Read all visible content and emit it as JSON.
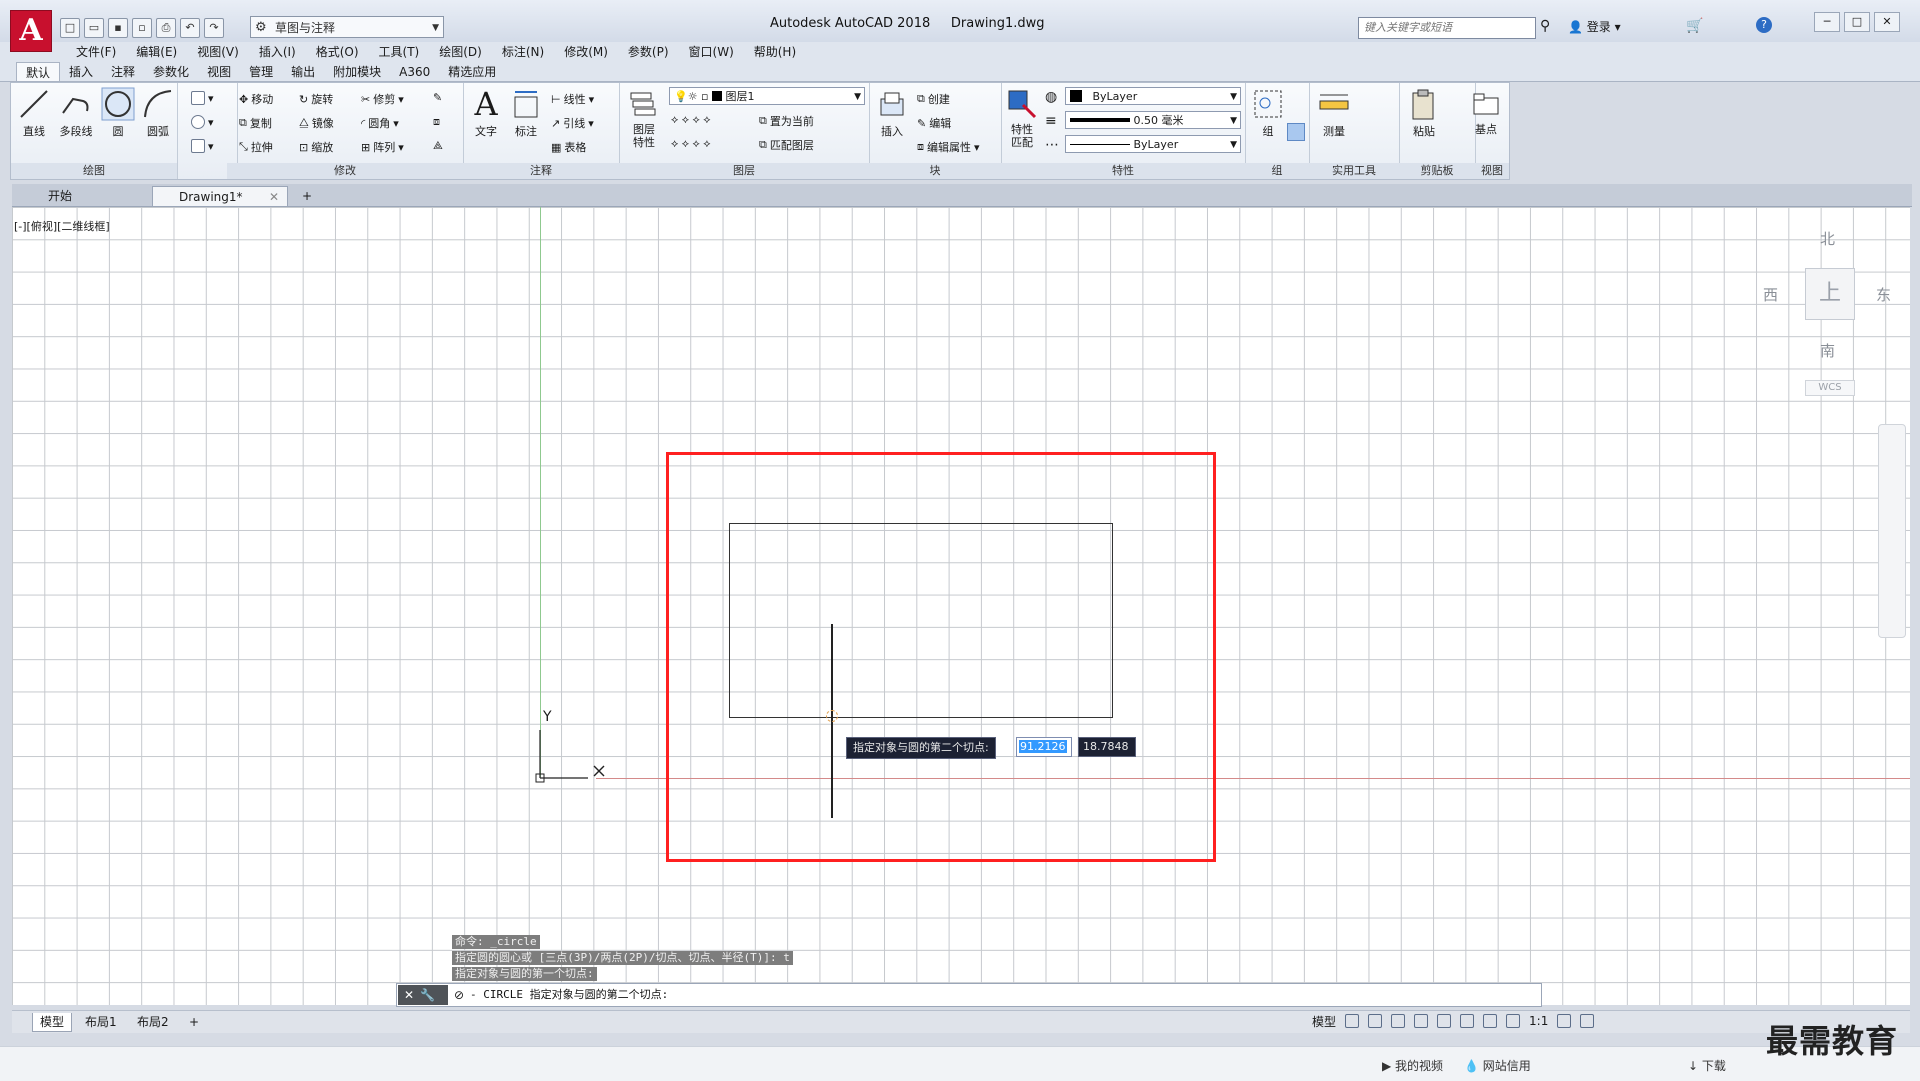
{
  "app": {
    "logo_letter": "A",
    "title": "Autodesk AutoCAD 2018",
    "document": "Drawing1.dwg",
    "workspace": "草图与注释",
    "search_placeholder": "键入关键字或短语",
    "login": "登录"
  },
  "menu": [
    "文件(F)",
    "编辑(E)",
    "视图(V)",
    "插入(I)",
    "格式(O)",
    "工具(T)",
    "绘图(D)",
    "标注(N)",
    "修改(M)",
    "参数(P)",
    "窗口(W)",
    "帮助(H)"
  ],
  "ribbon_tabs": [
    "默认",
    "插入",
    "注释",
    "参数化",
    "视图",
    "管理",
    "输出",
    "附加模块",
    "A360",
    "精选应用"
  ],
  "ribbon": {
    "draw": {
      "title": "绘图",
      "tools": [
        "直线",
        "多段线",
        "圆",
        "圆弧"
      ]
    },
    "modify": {
      "title": "修改",
      "rows": [
        [
          "移动",
          "旋转",
          "修剪"
        ],
        [
          "复制",
          "镜像",
          "圆角"
        ],
        [
          "拉伸",
          "缩放",
          "阵列"
        ]
      ]
    },
    "annotation": {
      "title": "注释",
      "tools": [
        "文字",
        "标注"
      ],
      "rows": [
        "线性",
        "引线",
        "表格"
      ]
    },
    "layers": {
      "title": "图层",
      "big": "图层\n特性",
      "layer_name": "图层1",
      "rows": [
        "置为当前",
        "匹配图层"
      ]
    },
    "block": {
      "title": "块",
      "big": "插入",
      "rows": [
        "创建",
        "编辑",
        "编辑属性"
      ]
    },
    "properties": {
      "title": "特性",
      "big": "特性\n匹配",
      "color": "ByLayer",
      "lineweight": "0.50 毫米",
      "linetype": "ByLayer"
    },
    "groups": {
      "title": "组",
      "big": "组"
    },
    "utilities": {
      "title": "实用工具",
      "big": "测量"
    },
    "clipboard": {
      "title": "剪贴板",
      "big": "粘贴"
    },
    "view": {
      "title": "视图",
      "big": "基点"
    }
  },
  "doc_tabs": [
    "开始",
    "Drawing1*"
  ],
  "viewport_label": "[-][俯视][二维线框]",
  "viewcube": {
    "north": "北",
    "south": "南",
    "east": "东",
    "west": "西",
    "face": "上",
    "wcs": "WCS"
  },
  "ucs": {
    "x": "X",
    "y": "Y"
  },
  "dynamic_input": {
    "prompt": "指定对象与圆的第二个切点:",
    "x_value": "91.2126",
    "y_value": "18.7848"
  },
  "command_history": [
    "命令: _circle",
    "指定圆的圆心或 [三点(3P)/两点(2P)/切点、切点、半径(T)]: t",
    "指定对象与圆的第一个切点:"
  ],
  "command_line": "CIRCLE 指定对象与圆的第二个切点:",
  "layout_tabs": [
    "模型",
    "布局1",
    "布局2"
  ],
  "status": {
    "model": "模型",
    "scale": "1:1"
  },
  "bottom_bar": {
    "video": "我的视频",
    "website": "网站信用",
    "download": "下载"
  },
  "watermark": "最需教育",
  "colors": {
    "highlight_box": "#ff2020",
    "crosshair_red": "#c85a5a",
    "crosshair_green": "#4caf50",
    "logo_red": "#c8102e"
  }
}
